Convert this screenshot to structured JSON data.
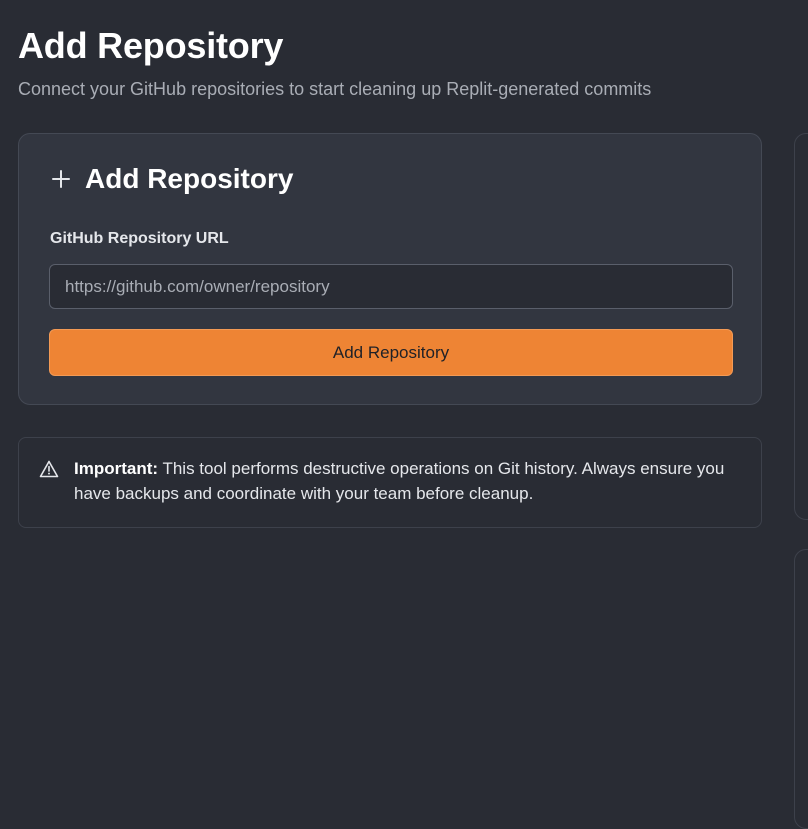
{
  "header": {
    "title": "Add Repository",
    "subtitle": "Connect your GitHub repositories to start cleaning up Replit-generated commits"
  },
  "add_card": {
    "title": "Add Repository",
    "icon": "plus-icon",
    "url_label": "GitHub Repository URL",
    "url_value": "",
    "url_placeholder": "https://github.com/owner/repository",
    "button_label": "Add Repository"
  },
  "alert": {
    "icon": "warning-triangle-icon",
    "strong": "Important:",
    "text": " This tool performs destructive operations on Git history. Always ensure you have backups and coordinate with your team before cleanup."
  },
  "colors": {
    "background": "#292c34",
    "card": "#323640",
    "accent": "#ee8434"
  }
}
